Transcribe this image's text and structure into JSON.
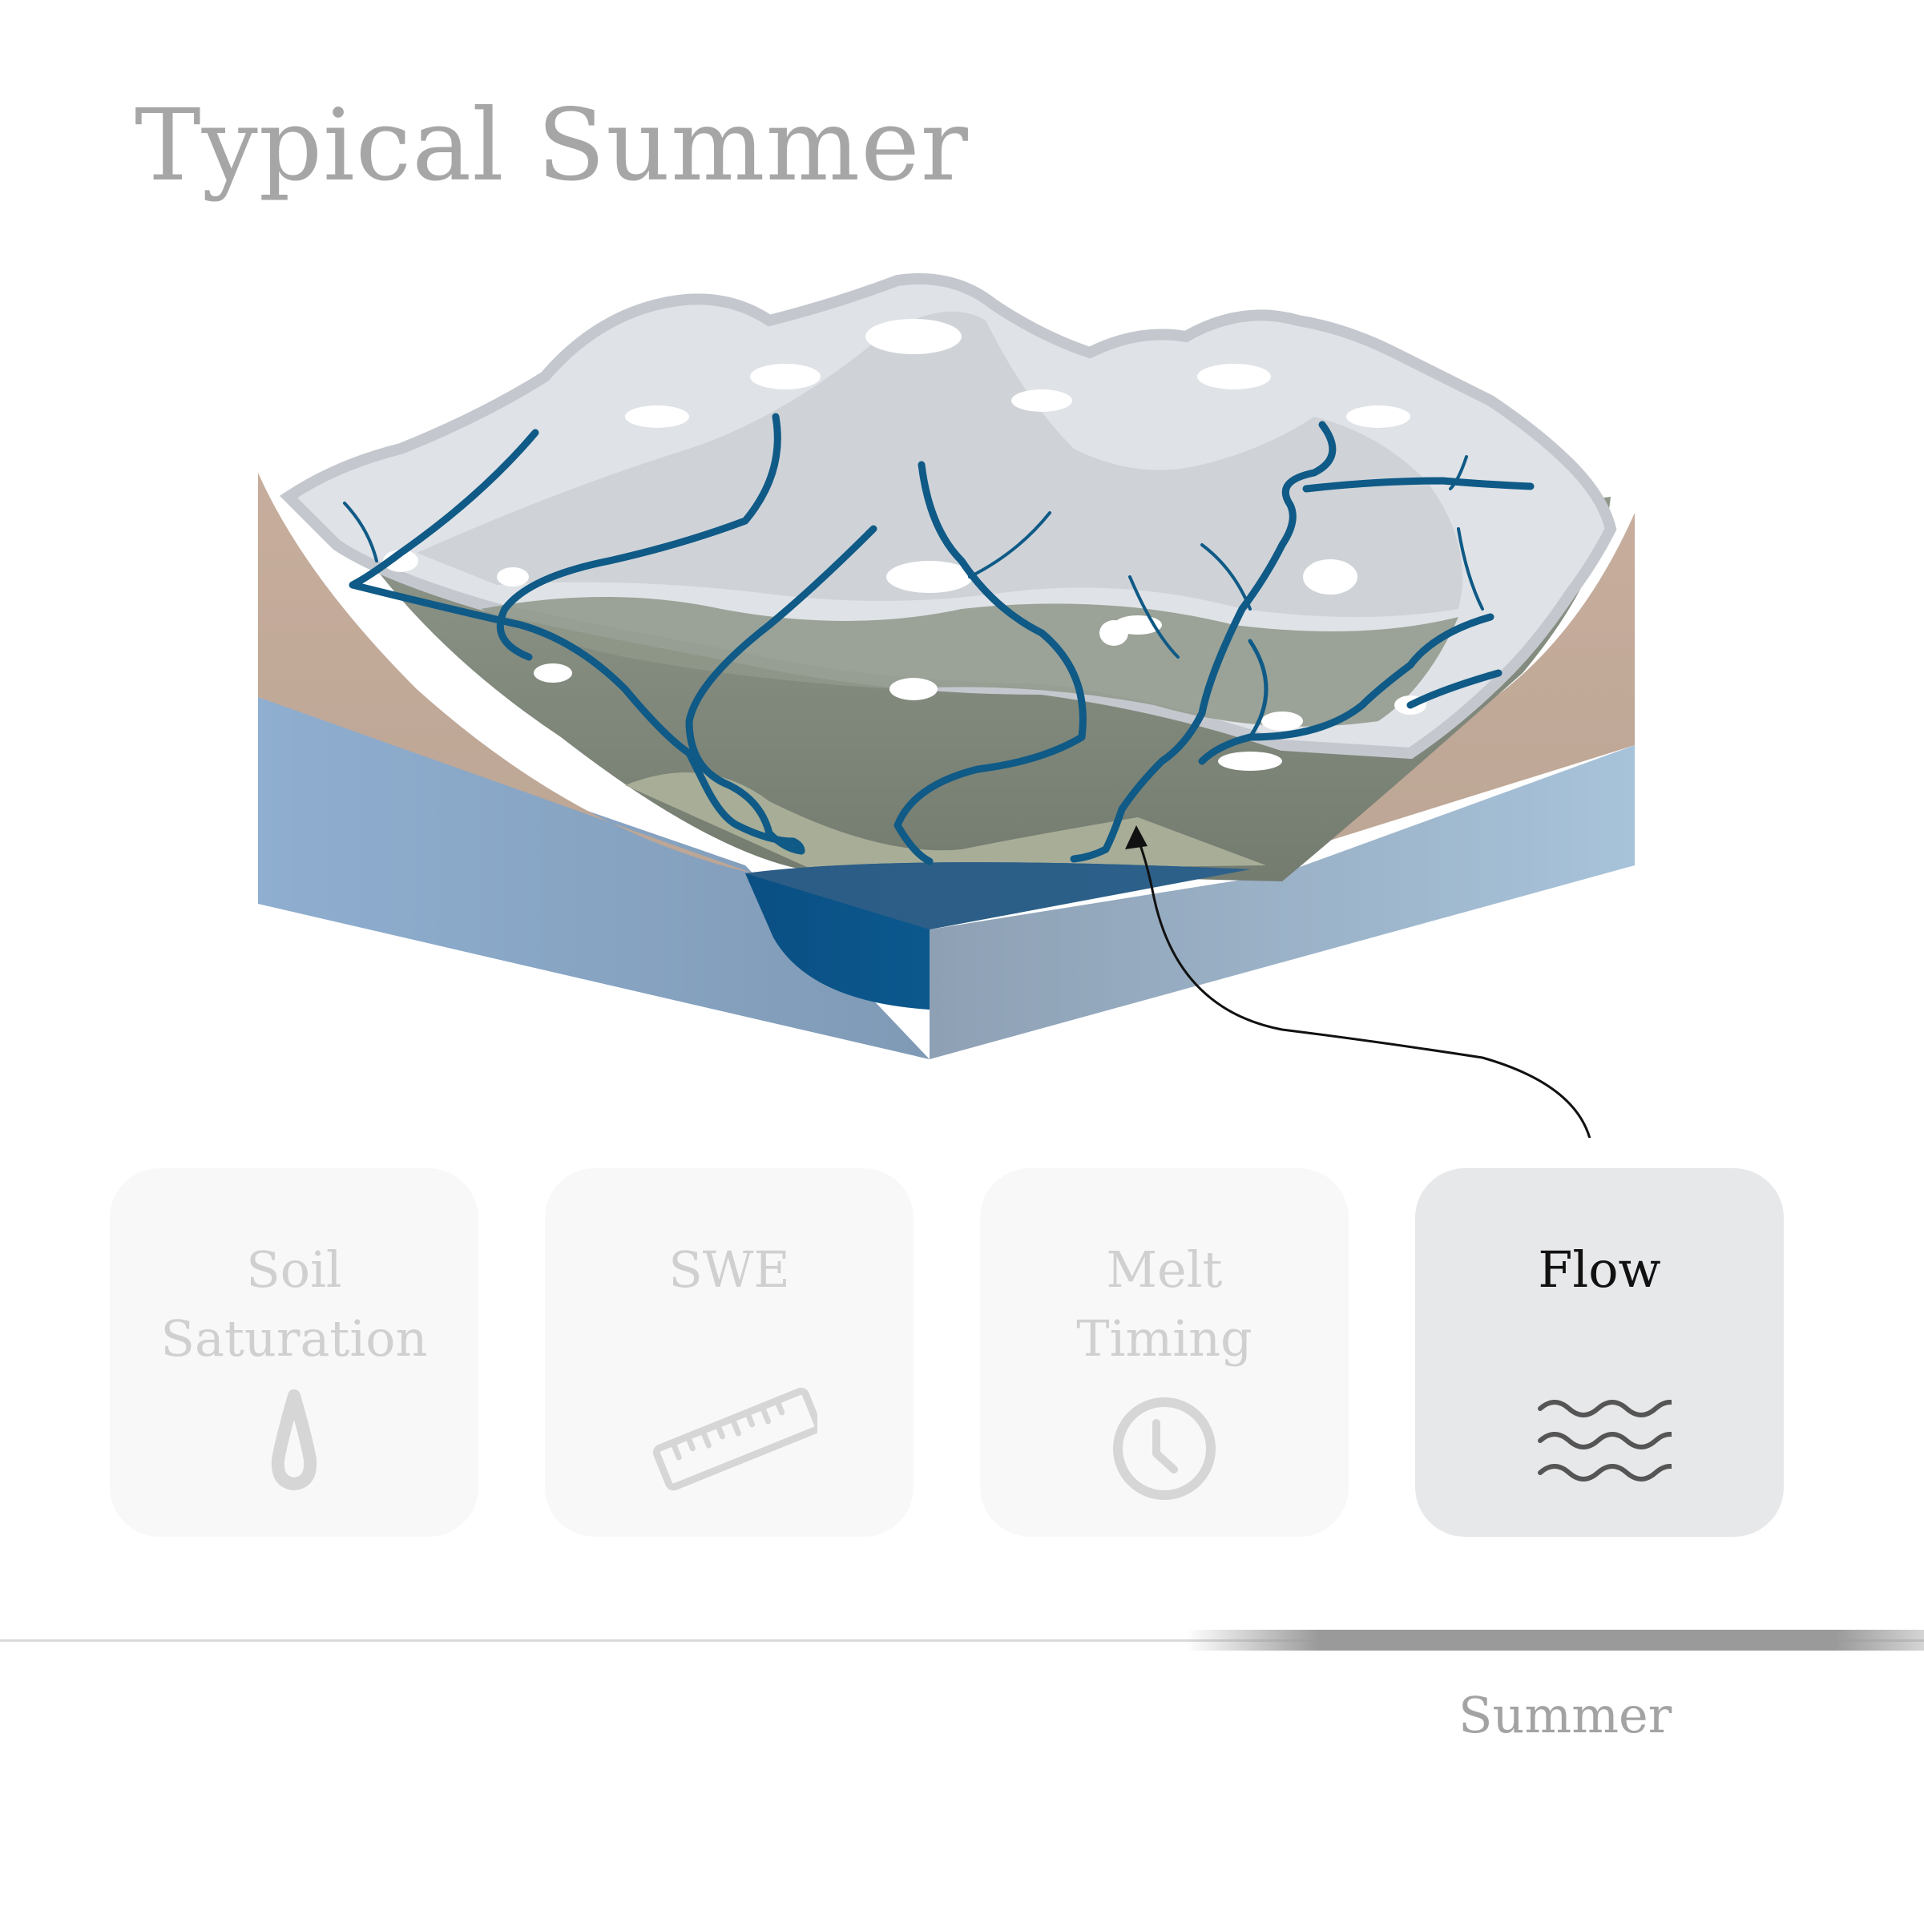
{
  "title": "Typical Summer",
  "cards": [
    {
      "label_lines": [
        "Soil",
        "Saturation"
      ],
      "icon": "droplet-icon",
      "active": false
    },
    {
      "label_lines": [
        "SWE"
      ],
      "icon": "ruler-icon",
      "active": false
    },
    {
      "label_lines": [
        "Melt",
        "Timing"
      ],
      "icon": "clock-icon",
      "active": false
    },
    {
      "label_lines": [
        "Flow"
      ],
      "icon": "waves-icon",
      "active": true
    }
  ],
  "timeline": {
    "season_label": "Summer"
  },
  "colors": {
    "river": "#0f5a86",
    "lake": "#0d5b8f",
    "groundwater": "#93b1cc",
    "soil": "#c1aa98",
    "valley": "#7d8678",
    "snow": "#e7e9ec",
    "rock": "#c0c4cb"
  }
}
